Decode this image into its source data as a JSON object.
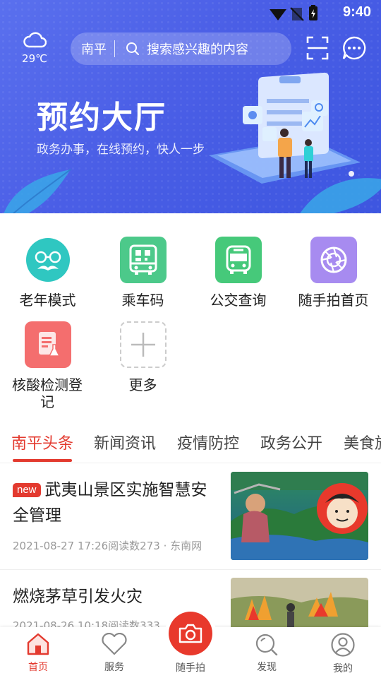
{
  "status_bar": {
    "time": "9:40"
  },
  "header": {
    "weather_temp": "29℃",
    "city": "南平",
    "search_placeholder": "搜索感兴趣的内容"
  },
  "banner": {
    "title": "预约大厅",
    "subtitle": "政务办事，在线预约，快人一步"
  },
  "quick_grid": [
    {
      "label": "老年模式",
      "icon": "elder-face-icon",
      "color": "#2fc7c1"
    },
    {
      "label": "乘车码",
      "icon": "bus-qr-code-icon",
      "color": "#4cc98a"
    },
    {
      "label": "公交查询",
      "icon": "bus-icon",
      "color": "#46c97a"
    },
    {
      "label": "随手拍首页",
      "icon": "camera-shutter-icon",
      "color": "#a78bf0"
    },
    {
      "label": "核酸检测登记",
      "icon": "lab-report-icon",
      "color": "#f46e6e"
    },
    {
      "label": "更多",
      "icon": "plus-icon",
      "color": "#cccccc"
    }
  ],
  "tabs": [
    "南平头条",
    "新闻资讯",
    "疫情防控",
    "政务公开",
    "美食旅"
  ],
  "active_tab": 0,
  "news": [
    {
      "badge": "new",
      "title": "武夷山景区实施智慧安全管理",
      "meta": "2021-08-27 17:26阅读数273 · 东南网"
    },
    {
      "badge": "",
      "title": "燃烧茅草引发火灾",
      "meta": "2021-08-26 10:18阅读数333"
    }
  ],
  "bottom_nav": [
    {
      "label": "首页",
      "icon": "home-icon"
    },
    {
      "label": "服务",
      "icon": "heart-icon"
    },
    {
      "label": "随手拍",
      "icon": "camera-icon"
    },
    {
      "label": "发现",
      "icon": "discover-search-icon"
    },
    {
      "label": "我的",
      "icon": "user-icon"
    }
  ],
  "colors": {
    "accent": "#e33a2f",
    "banner": "#4a5ee6"
  }
}
